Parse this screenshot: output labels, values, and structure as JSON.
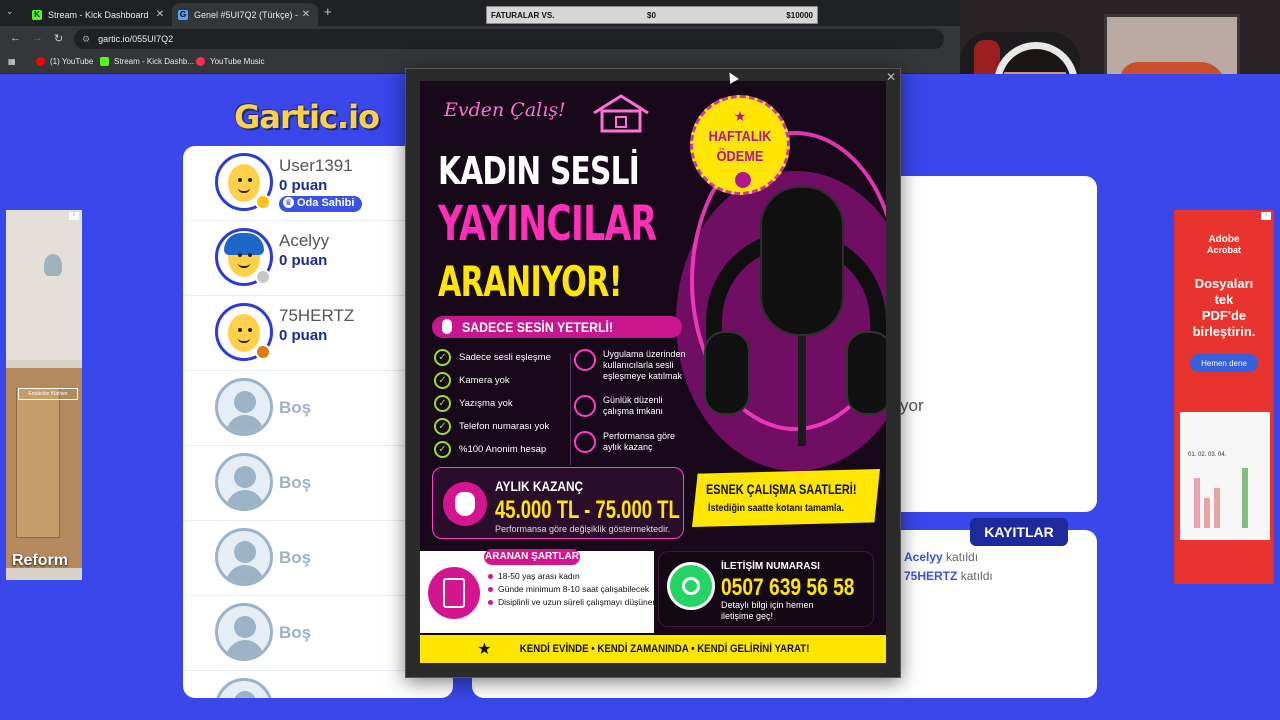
{
  "browser": {
    "tabs": [
      {
        "title": "Stream - Kick Dashboard",
        "favicon": "K",
        "favicon_color": "#53fc18"
      },
      {
        "title": "Genel #5UI7Q2 (Türkçe) - Gartic",
        "favicon": "G",
        "favicon_color": "#4fa6ff"
      }
    ],
    "address": "gartic.io/055UI7Q2",
    "bookmarks": [
      {
        "label": "(1) YouTube",
        "color": "#ff0000"
      },
      {
        "label": "Stream - Kick Dashb...",
        "color": "#53fc18"
      },
      {
        "label": "YouTube Music",
        "color": "#ff2d55"
      }
    ]
  },
  "overlay": {
    "bills_label": "FATURALAR VS.",
    "bills_start": "$0",
    "bills_goal": "$10000"
  },
  "game": {
    "logo": "Gartic.io",
    "players": [
      {
        "name": "User1391",
        "points": "0 puan",
        "badge": "Oda Sahibi",
        "status_color": "#ffc21a",
        "avatar": "smile"
      },
      {
        "name": "Acelyy",
        "points": "0 puan",
        "status_color": "#c8c8c8",
        "avatar": "girl"
      },
      {
        "name": "75HERTZ",
        "points": "0 puan",
        "status_color": "#e07a10",
        "avatar": "smile"
      }
    ],
    "empty_slot_label": "Boş",
    "board_partial_text": "yor",
    "logs_title": "KAYITLAR",
    "logs": [
      {
        "user": "Acelyy",
        "action": "katıldı"
      },
      {
        "user": "75HERTZ",
        "action": "katıldı"
      }
    ]
  },
  "ads": {
    "left": {
      "brand": "Reform",
      "mini_label": "Entdecke Küchen"
    },
    "right": {
      "brand_line1": "Adobe",
      "brand_line2": "Acrobat",
      "headline": [
        "Dosyaları",
        "tek",
        "PDF'de",
        "birleştirin."
      ],
      "cta": "Hemen dene",
      "doc_text": "01. 02. 03. 04."
    }
  },
  "poster": {
    "script": "Evden Çalış!",
    "h1": "KADIN SESLİ",
    "h2": "YAYINCILAR",
    "h3": "ARANIYOR!",
    "badge_line1": "HAFTALIK",
    "badge_line2": "ÖDEME",
    "pill": "SADECE SESİN YETERLİ!",
    "checks": [
      "Sadece sesli eşleşme",
      "Kamera yok",
      "Yazışma yok",
      "Telefon numarası yok",
      "%100 Anonim hesap"
    ],
    "features": [
      "Uygulama üzerinden kullanıcılarla sesli eşleşmeye katılmak",
      "Günlük düzenli çalışma imkanı",
      "Performansa göre aylık kazanç"
    ],
    "earn_title": "AYLIK KAZANÇ",
    "earn_amount": "45.000 TL - 75.000 TL",
    "earn_note": "Performansa göre değişiklik göstermektedir.",
    "flex_title": "ESNEK ÇALIŞMA SAATLERİ!",
    "flex_sub": "İstediğin saatte kotanı tamamla.",
    "req_title": "ARANAN ŞARTLAR",
    "requirements": [
      "18-50 yaş arası kadın",
      "Günde minimum 8-10 saat çalışabilecek",
      "Disiplinli ve uzun süreli çalışmayı düşünen"
    ],
    "contact_title": "İLETİŞİM NUMARASI",
    "contact_number": "0507 639 56 58",
    "contact_note": "Detaylı bilgi için hemen iletişime geç!",
    "footer": "KENDİ EVİNDE  •  KENDİ ZAMANINDA  •  KENDİ GELİRİNİ YARAT!"
  },
  "colors": {
    "page_bg": "#3a47ea",
    "accent_navy": "#1c2a9a",
    "poster_pink": "#ff2fb9",
    "poster_yellow": "#ffe600"
  }
}
